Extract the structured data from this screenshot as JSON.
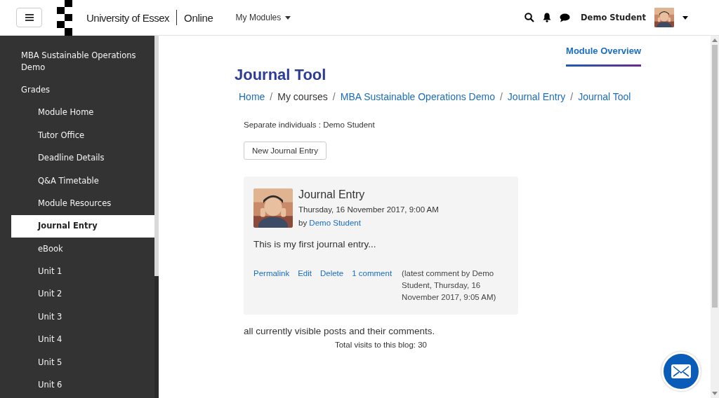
{
  "header": {
    "brand": "University of Essex",
    "brand_suffix": "Online",
    "menu": "My Modules",
    "user": "Demo Student"
  },
  "sidebar": {
    "items": [
      {
        "label": "MBA Sustainable Operations Demo",
        "kind": "top",
        "selected": false
      },
      {
        "label": "Grades",
        "kind": "top",
        "selected": false
      },
      {
        "label": "Module Home",
        "kind": "sub",
        "selected": false
      },
      {
        "label": "Tutor Office",
        "kind": "sub",
        "selected": false
      },
      {
        "label": "Deadline Details",
        "kind": "sub",
        "selected": false
      },
      {
        "label": "Q&A Timetable",
        "kind": "sub",
        "selected": false
      },
      {
        "label": "Module Resources",
        "kind": "sub",
        "selected": false
      },
      {
        "label": "Journal Entry",
        "kind": "sub",
        "selected": true
      },
      {
        "label": "eBook",
        "kind": "sub",
        "selected": false
      },
      {
        "label": "Unit 1",
        "kind": "sub",
        "selected": false
      },
      {
        "label": "Unit 2",
        "kind": "sub",
        "selected": false
      },
      {
        "label": "Unit 3",
        "kind": "sub",
        "selected": false
      },
      {
        "label": "Unit 4",
        "kind": "sub",
        "selected": false
      },
      {
        "label": "Unit 5",
        "kind": "sub",
        "selected": false
      },
      {
        "label": "Unit 6",
        "kind": "sub",
        "selected": false
      }
    ]
  },
  "overview_link": "Module Overview",
  "title": "Journal Tool",
  "breadcrumb_separator": "/",
  "breadcrumb": [
    {
      "label": "Home",
      "link": true
    },
    {
      "label": "My courses",
      "link": false
    },
    {
      "label": "MBA Sustainable Operations Demo",
      "link": true
    },
    {
      "label": "Journal Entry",
      "link": true
    },
    {
      "label": "Journal Tool",
      "link": true
    }
  ],
  "group_info": "Separate individuals : Demo Student",
  "new_button": "New Journal Entry",
  "entry": {
    "title": "Journal Entry",
    "date": "Thursday, 16 November 2017, 9:00 AM",
    "by": "by",
    "author": "Demo Student",
    "body": "This is my first journal entry...",
    "actions": [
      "Permalink",
      "Edit",
      "Delete",
      "1 comment"
    ],
    "latest": "(latest comment by Demo Student, Thursday, 16 November 2017, 9:05 AM)"
  },
  "footer_note": "all currently visible posts and their comments.",
  "visits": "Total visits to this blog: 30"
}
